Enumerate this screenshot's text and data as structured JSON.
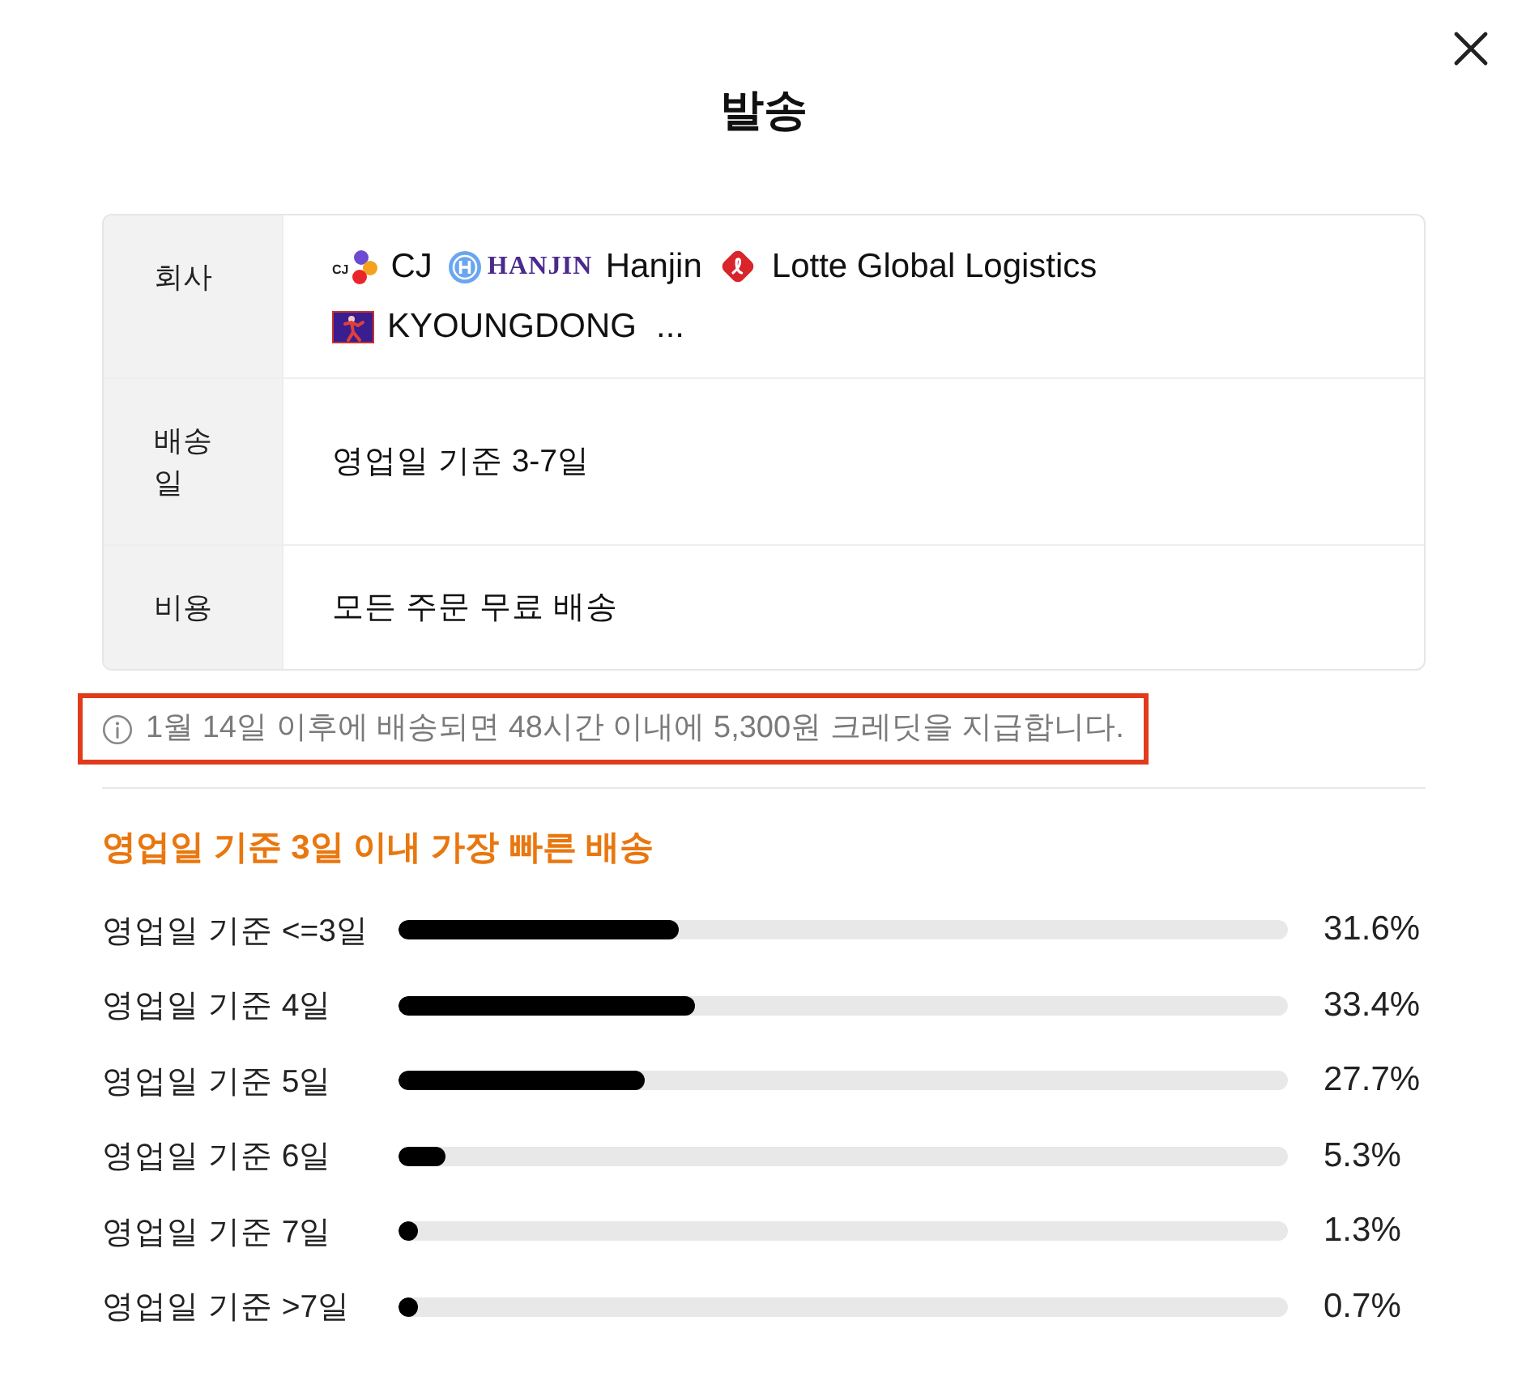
{
  "dialog": {
    "title": "발송"
  },
  "details": [
    {
      "kind": "carriers",
      "label": "회사",
      "carriers": [
        {
          "name": "CJ",
          "kind": "petals",
          "logo_text": "CJ"
        },
        {
          "name": "Hanjin",
          "kind": "circle",
          "logo_text": "HANJIN"
        },
        {
          "name": "Lotte Global Logistics",
          "kind": "diamond"
        },
        {
          "name": "KYOUNGDONG",
          "kind": "runner"
        }
      ],
      "more": "..."
    },
    {
      "kind": "text",
      "label": "배송일",
      "value": "영업일 기준 3-7일"
    },
    {
      "kind": "text",
      "label": "비용",
      "value": "모든 주문 무료 배송"
    }
  ],
  "notice": {
    "text": "1월 14일 이후에 배송되면 48시간 이내에 5,300원 크레딧을 지급합니다.",
    "highlighted": true
  },
  "speed": {
    "heading": "영업일 기준 3일 이내 가장 빠른 배송",
    "rows": [
      {
        "label": "영업일 기준 <=3일",
        "level": 0.316,
        "reading": "31.6%"
      },
      {
        "label": "영업일 기준 4일",
        "level": 0.334,
        "reading": "33.4%"
      },
      {
        "label": "영업일 기준 5일",
        "level": 0.277,
        "reading": "27.7%"
      },
      {
        "label": "영업일 기준 6일",
        "level": 0.053,
        "reading": "5.3%"
      },
      {
        "label": "영업일 기준 7일",
        "level": 0.013,
        "reading": "1.3%"
      },
      {
        "label": "영업일 기준 >7일",
        "level": 0.007,
        "reading": "0.7%"
      }
    ]
  }
}
